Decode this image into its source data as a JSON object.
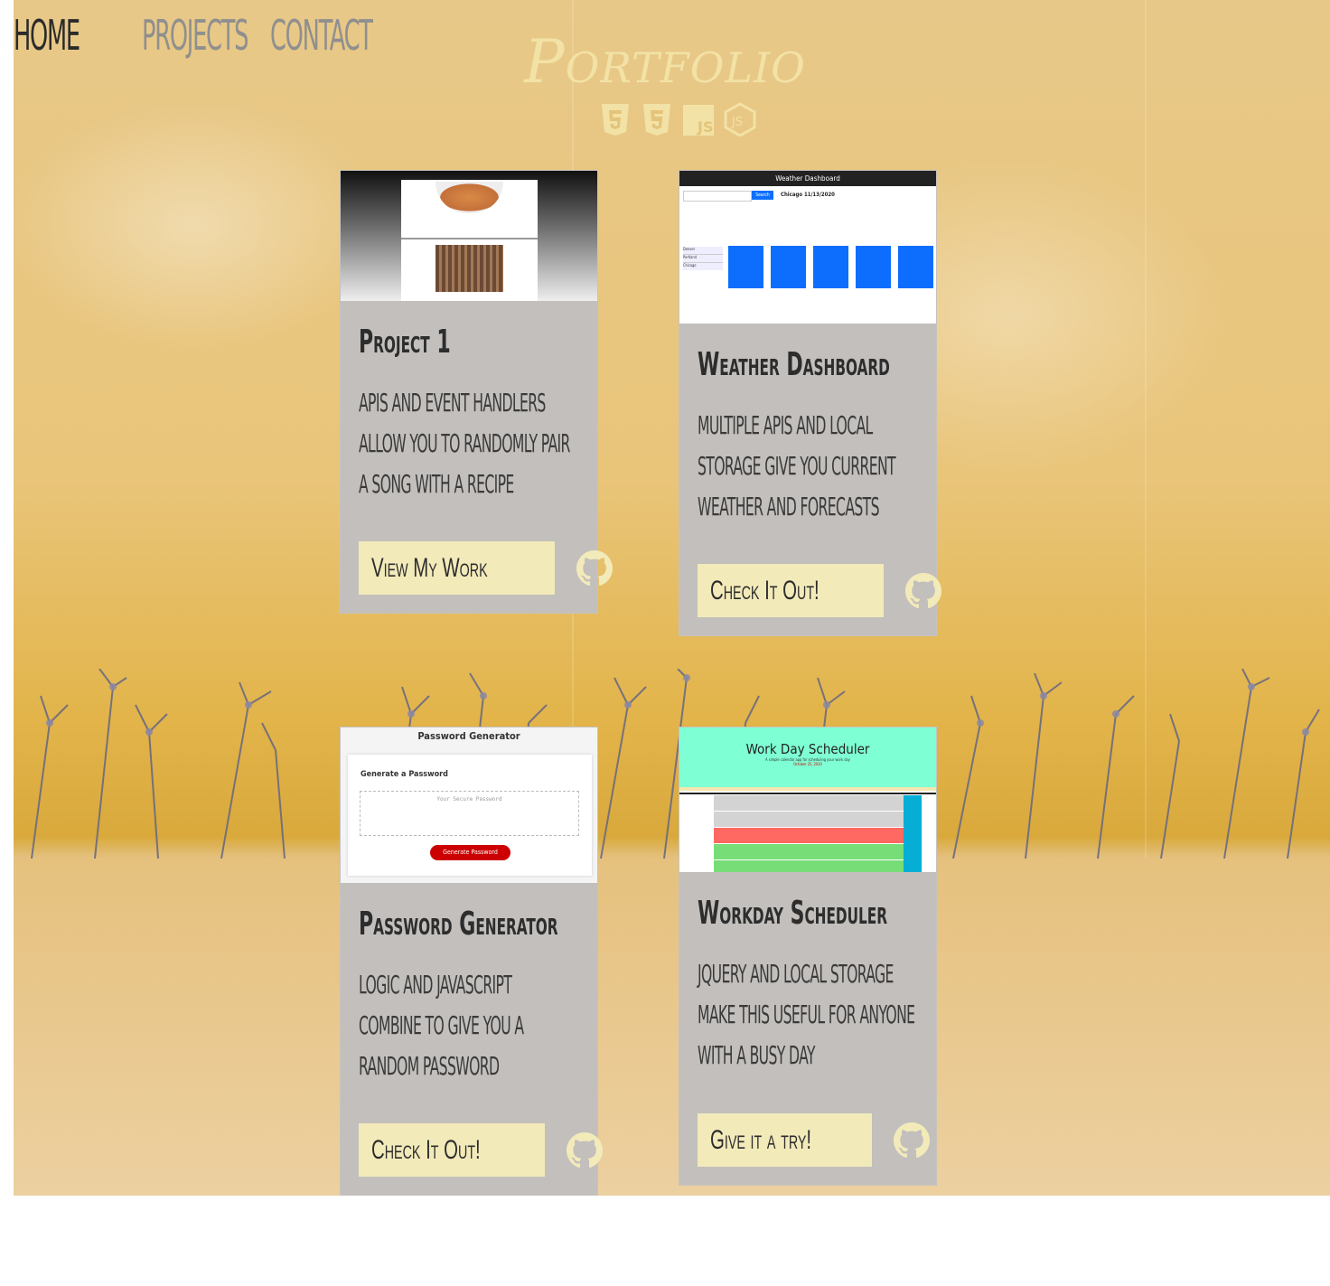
{
  "nav": {
    "items": [
      "HOME",
      "PROJECTS",
      "CONTACT"
    ],
    "active": "HOME"
  },
  "header": {
    "title": "Portfolio",
    "tech_icons": [
      "html5-icon",
      "css3-icon",
      "javascript-icon",
      "nodejs-icon"
    ],
    "title_color": "#f2e2a6"
  },
  "cards": [
    {
      "title": "Project 1",
      "description": "APIs and event handlers allow you to randomly pair a song with a recipe",
      "button": "View My Work",
      "screenshot": {
        "app": "recipe-song-app"
      }
    },
    {
      "title": "Weather Dashboard",
      "description": "Multiple APIs and local storage give you current weather and forecasts",
      "button": "Check It Out!",
      "screenshot": {
        "app_title": "Weather Dashboard",
        "search_button": "Search",
        "city_heading": "Chicago 11/13/2020",
        "cities": [
          "Denver",
          "Portland",
          "Chicago"
        ]
      }
    },
    {
      "title": "Password Generator",
      "description": "Logic and Javascript combine to give you a random password",
      "button": "Check It Out!",
      "screenshot": {
        "app_title": "Password Generator",
        "heading": "Generate a Password",
        "placeholder": "Your Secure Password",
        "button": "Generate Password"
      }
    },
    {
      "title": "Workday Scheduler",
      "description": "jQuery and local storage make this useful for anyone with a busy day",
      "button": "Give it a try!",
      "screenshot": {
        "app_title": "Work Day Scheduler",
        "subtitle": "A simple calendar app for scheduling your work day",
        "date": "October 25, 2020"
      }
    }
  ],
  "colors": {
    "card_bg": "#c2bfbc",
    "button_bg": "#f3eaba",
    "github_icon": "#f3eaba"
  }
}
